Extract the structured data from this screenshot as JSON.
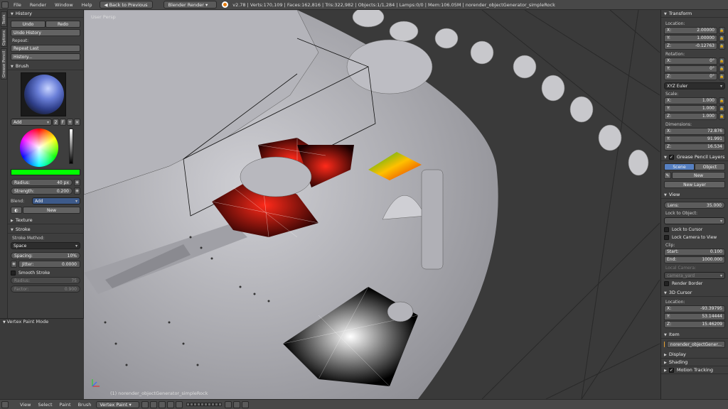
{
  "topbar": {
    "menus": [
      "File",
      "Render",
      "Window",
      "Help"
    ],
    "back_button": "Back to Previous",
    "engine": "Blender Render",
    "stats": "v2.78 | Verts:170,109 | Faces:162,816 | Tris:322,982 | Objects:1/1,284 | Lamps:0/0 | Mem:106.05M | norender_objectGenerator_simpleRock"
  },
  "tooltabs": [
    "Tools",
    "Options",
    "Grease Pencil"
  ],
  "toolshelf": {
    "history": {
      "title": "History",
      "undo": "Undo",
      "redo": "Redo",
      "undo_history": "Undo History",
      "repeat_label": "Repeat:",
      "repeat_last": "Repeat Last",
      "history": "History..."
    },
    "brush": {
      "title": "Brush",
      "brush_name": "Add",
      "brush_users": "2",
      "brush_fake": "F",
      "color": "#00ff00",
      "radius_label": "Radius:",
      "radius_value": "40 px",
      "strength_label": "Strength:",
      "strength_value": "0.200",
      "blend_label": "Blend:",
      "blend_value": "Add",
      "new": "New"
    },
    "texture": {
      "title": "Texture"
    },
    "stroke": {
      "title": "Stroke",
      "method_label": "Stroke Method:",
      "method_value": "Space",
      "spacing_label": "Spacing:",
      "spacing_value": "10%",
      "jitter_label": "Jitter:",
      "jitter_value": "0.0000",
      "smooth": "Smooth Stroke",
      "radius_label": "Radius:",
      "radius_value": "75",
      "factor_label": "Factor:",
      "factor_value": "0.900"
    }
  },
  "mode_label": "Vertex Paint Mode",
  "viewport": {
    "view_label": "User Persp",
    "object_label": "(1) norender_objectGenerator_simpleRock"
  },
  "npanel": {
    "transform": {
      "title": "Transform",
      "location_label": "Location:",
      "loc_x": "2.00000",
      "loc_y": "1.00000",
      "loc_z": "-0.12763",
      "rotation_label": "Rotation:",
      "rot_x": "0°",
      "rot_y": "0°",
      "rot_z": "0°",
      "rot_mode": "XYZ Euler",
      "scale_label": "Scale:",
      "scl_x": "1.000",
      "scl_y": "1.000",
      "scl_z": "1.000",
      "dim_label": "Dimensions:",
      "dim_x": "72.876",
      "dim_y": "91.991",
      "dim_z": "16.534"
    },
    "grease": {
      "title": "Grease Pencil Layers",
      "scene": "Scene",
      "object": "Object",
      "new": "New",
      "new_layer": "New Layer"
    },
    "view": {
      "title": "View",
      "lens_label": "Lens:",
      "lens_value": "35.000",
      "lock_object_label": "Lock to Object:",
      "lock_cursor": "Lock to Cursor",
      "lock_camera": "Lock Camera to View",
      "clip_label": "Clip:",
      "clip_start_label": "Start:",
      "clip_start": "0.100",
      "clip_end_label": "End:",
      "clip_end": "1000.000",
      "local_camera_label": "Local Camera:",
      "local_camera": "camera_yard",
      "render_border": "Render Border"
    },
    "cursor": {
      "title": "3D Cursor",
      "location_label": "Location:",
      "x": "-93.39795",
      "y": "53.14444",
      "z": "15.46209"
    },
    "item": {
      "title": "Item",
      "name": "norender_objectGener..."
    },
    "display": "Display",
    "shading": "Shading",
    "motion": "Motion Tracking"
  },
  "bottombar": {
    "menus": [
      "View",
      "Select",
      "Paint",
      "Brush"
    ],
    "mode": "Vertex Paint"
  }
}
